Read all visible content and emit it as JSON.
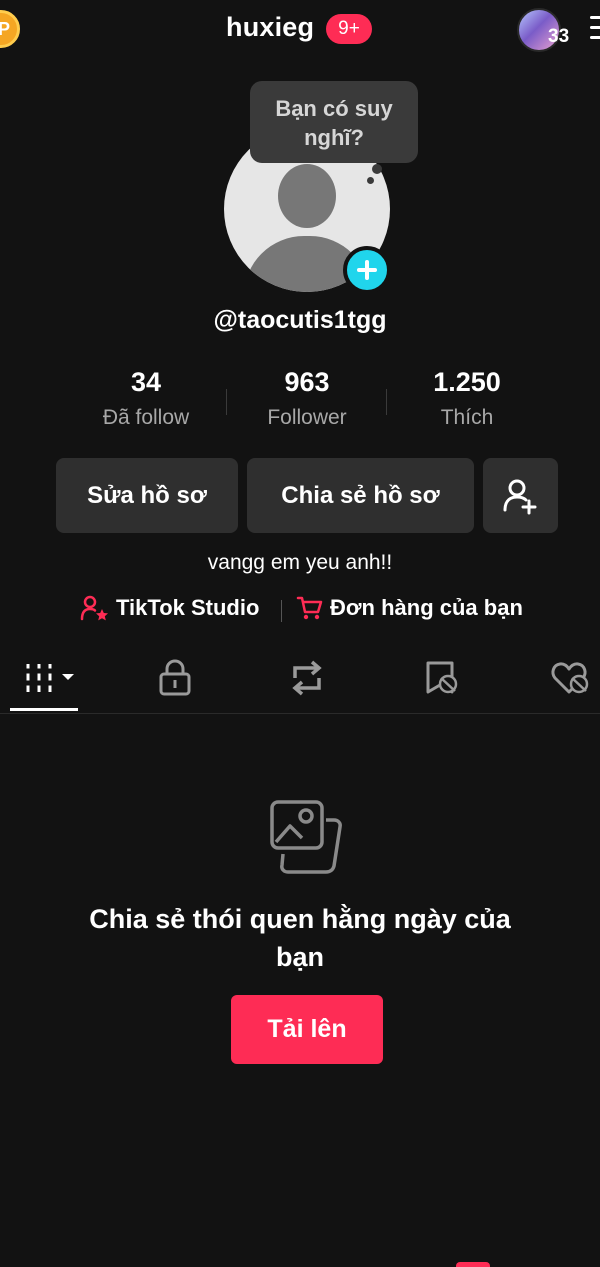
{
  "header": {
    "coin_label": "P",
    "title": "huxieg",
    "notification_badge": "9+",
    "friends_count": "33"
  },
  "profile": {
    "thought_bubble": "Bạn có suy nghĩ?",
    "handle": "@taocutis1tgg",
    "bio": "vangg em yeu anh!!"
  },
  "stats": [
    {
      "value": "34",
      "label": "Đã follow"
    },
    {
      "value": "963",
      "label": "Follower"
    },
    {
      "value": "1.250",
      "label": "Thích"
    }
  ],
  "actions": {
    "edit_profile": "Sửa hồ sơ",
    "share_profile": "Chia sẻ hồ sơ"
  },
  "links": {
    "studio": "TikTok Studio",
    "orders": "Đơn hàng của bạn"
  },
  "tabs": [
    "videos-grid",
    "private",
    "reposts",
    "favorites",
    "liked"
  ],
  "empty_state": {
    "title": "Chia sẻ thói quen hằng ngày của bạn",
    "upload_button": "Tải lên"
  },
  "colors": {
    "background": "#121212",
    "accent_red": "#fe2c55",
    "accent_cyan": "#20d5ec",
    "button_bg": "#2f2f2f"
  }
}
